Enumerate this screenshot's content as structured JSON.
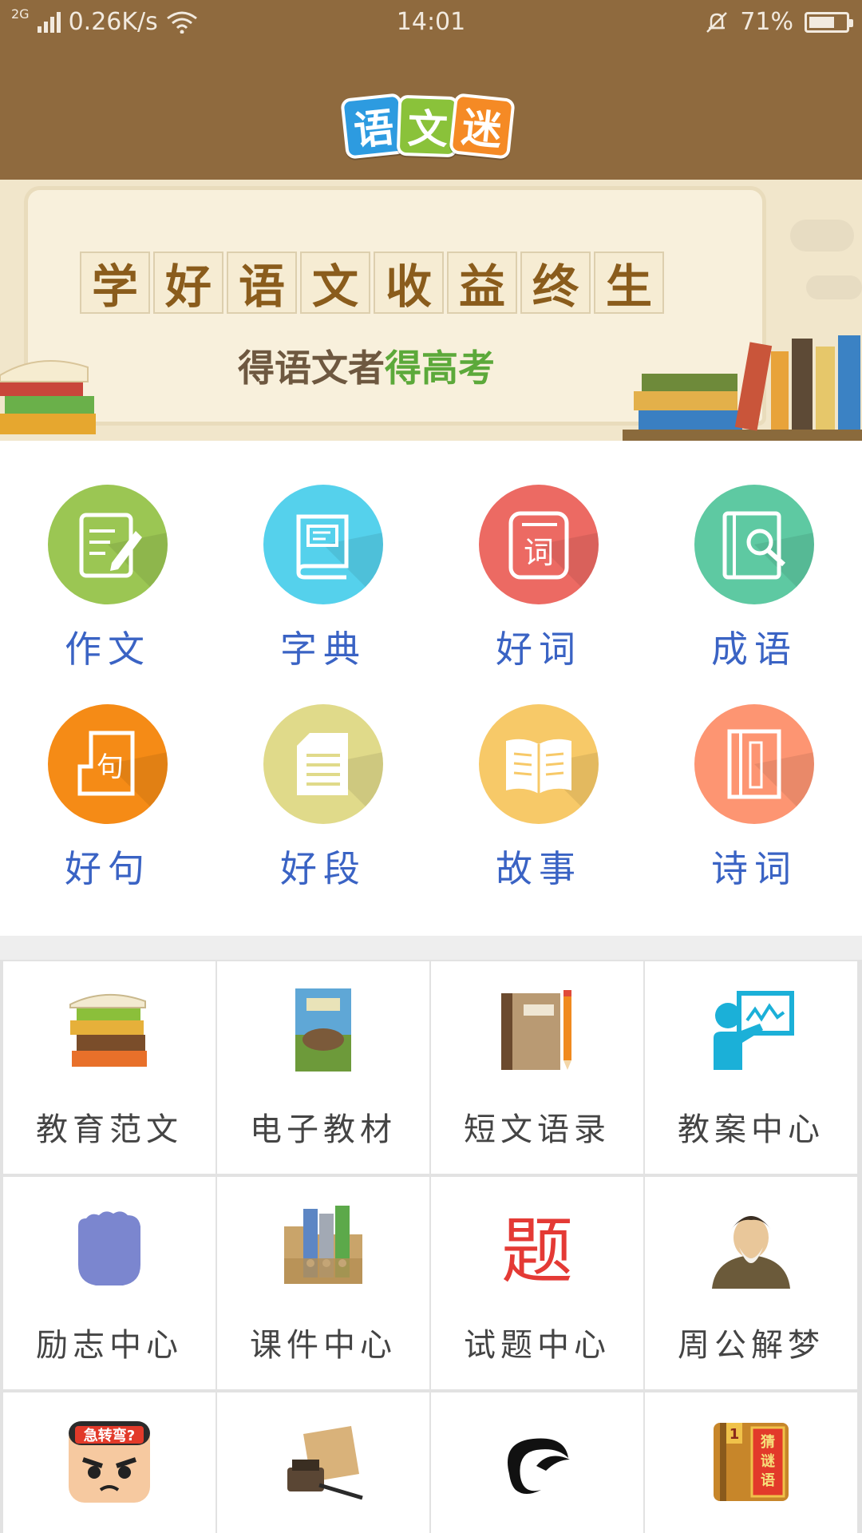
{
  "status_bar": {
    "network": "2G",
    "speed": "0.26K/s",
    "time": "14:01",
    "battery": "71%",
    "battery_level": 0.71
  },
  "header": {
    "logo_chars": [
      "语",
      "文",
      "迷"
    ],
    "background_color": "#8f6a3e"
  },
  "banner": {
    "slogan_chars": [
      "学",
      "好",
      "语",
      "文",
      "收",
      "益",
      "终",
      "生"
    ],
    "subline_plain": "得语文者",
    "subline_highlight": "得高考"
  },
  "features": [
    {
      "label": "作文",
      "icon": "pencil-note-icon",
      "color": "#9bc653"
    },
    {
      "label": "字典",
      "icon": "dictionary-book-icon",
      "color": "#55d1ec"
    },
    {
      "label": "好词",
      "icon": "word-card-icon",
      "color": "#ec6a63",
      "glyph": "词"
    },
    {
      "label": "成语",
      "icon": "book-search-icon",
      "color": "#5ec9a2"
    },
    {
      "label": "好句",
      "icon": "sentence-card-icon",
      "color": "#f58b16",
      "glyph": "句"
    },
    {
      "label": "好段",
      "icon": "paragraph-document-icon",
      "color": "#e0da8a"
    },
    {
      "label": "故事",
      "icon": "open-book-icon",
      "color": "#f7c968"
    },
    {
      "label": "诗词",
      "icon": "poem-scroll-icon",
      "color": "#fd9572"
    }
  ],
  "tools": [
    {
      "label": "教育范文",
      "icon": "book-stack-icon"
    },
    {
      "label": "电子教材",
      "icon": "textbook-cover-icon"
    },
    {
      "label": "短文语录",
      "icon": "notebook-pencil-icon"
    },
    {
      "label": "教案中心",
      "icon": "teacher-board-icon"
    },
    {
      "label": "励志中心",
      "icon": "fist-icon"
    },
    {
      "label": "课件中心",
      "icon": "binders-folder-icon"
    },
    {
      "label": "试题中心",
      "icon": "exam-glyph-icon",
      "glyph": "题"
    },
    {
      "label": "周公解梦",
      "icon": "sage-portrait-icon"
    },
    {
      "label": "",
      "icon": "riddle-face-icon",
      "badge": "急转弯?"
    },
    {
      "label": "",
      "icon": "scroll-inkstone-icon"
    },
    {
      "label": "",
      "icon": "brush-stroke-icon"
    },
    {
      "label": "",
      "icon": "riddle-book-icon",
      "badge": "猜谜语",
      "number": "1"
    }
  ]
}
